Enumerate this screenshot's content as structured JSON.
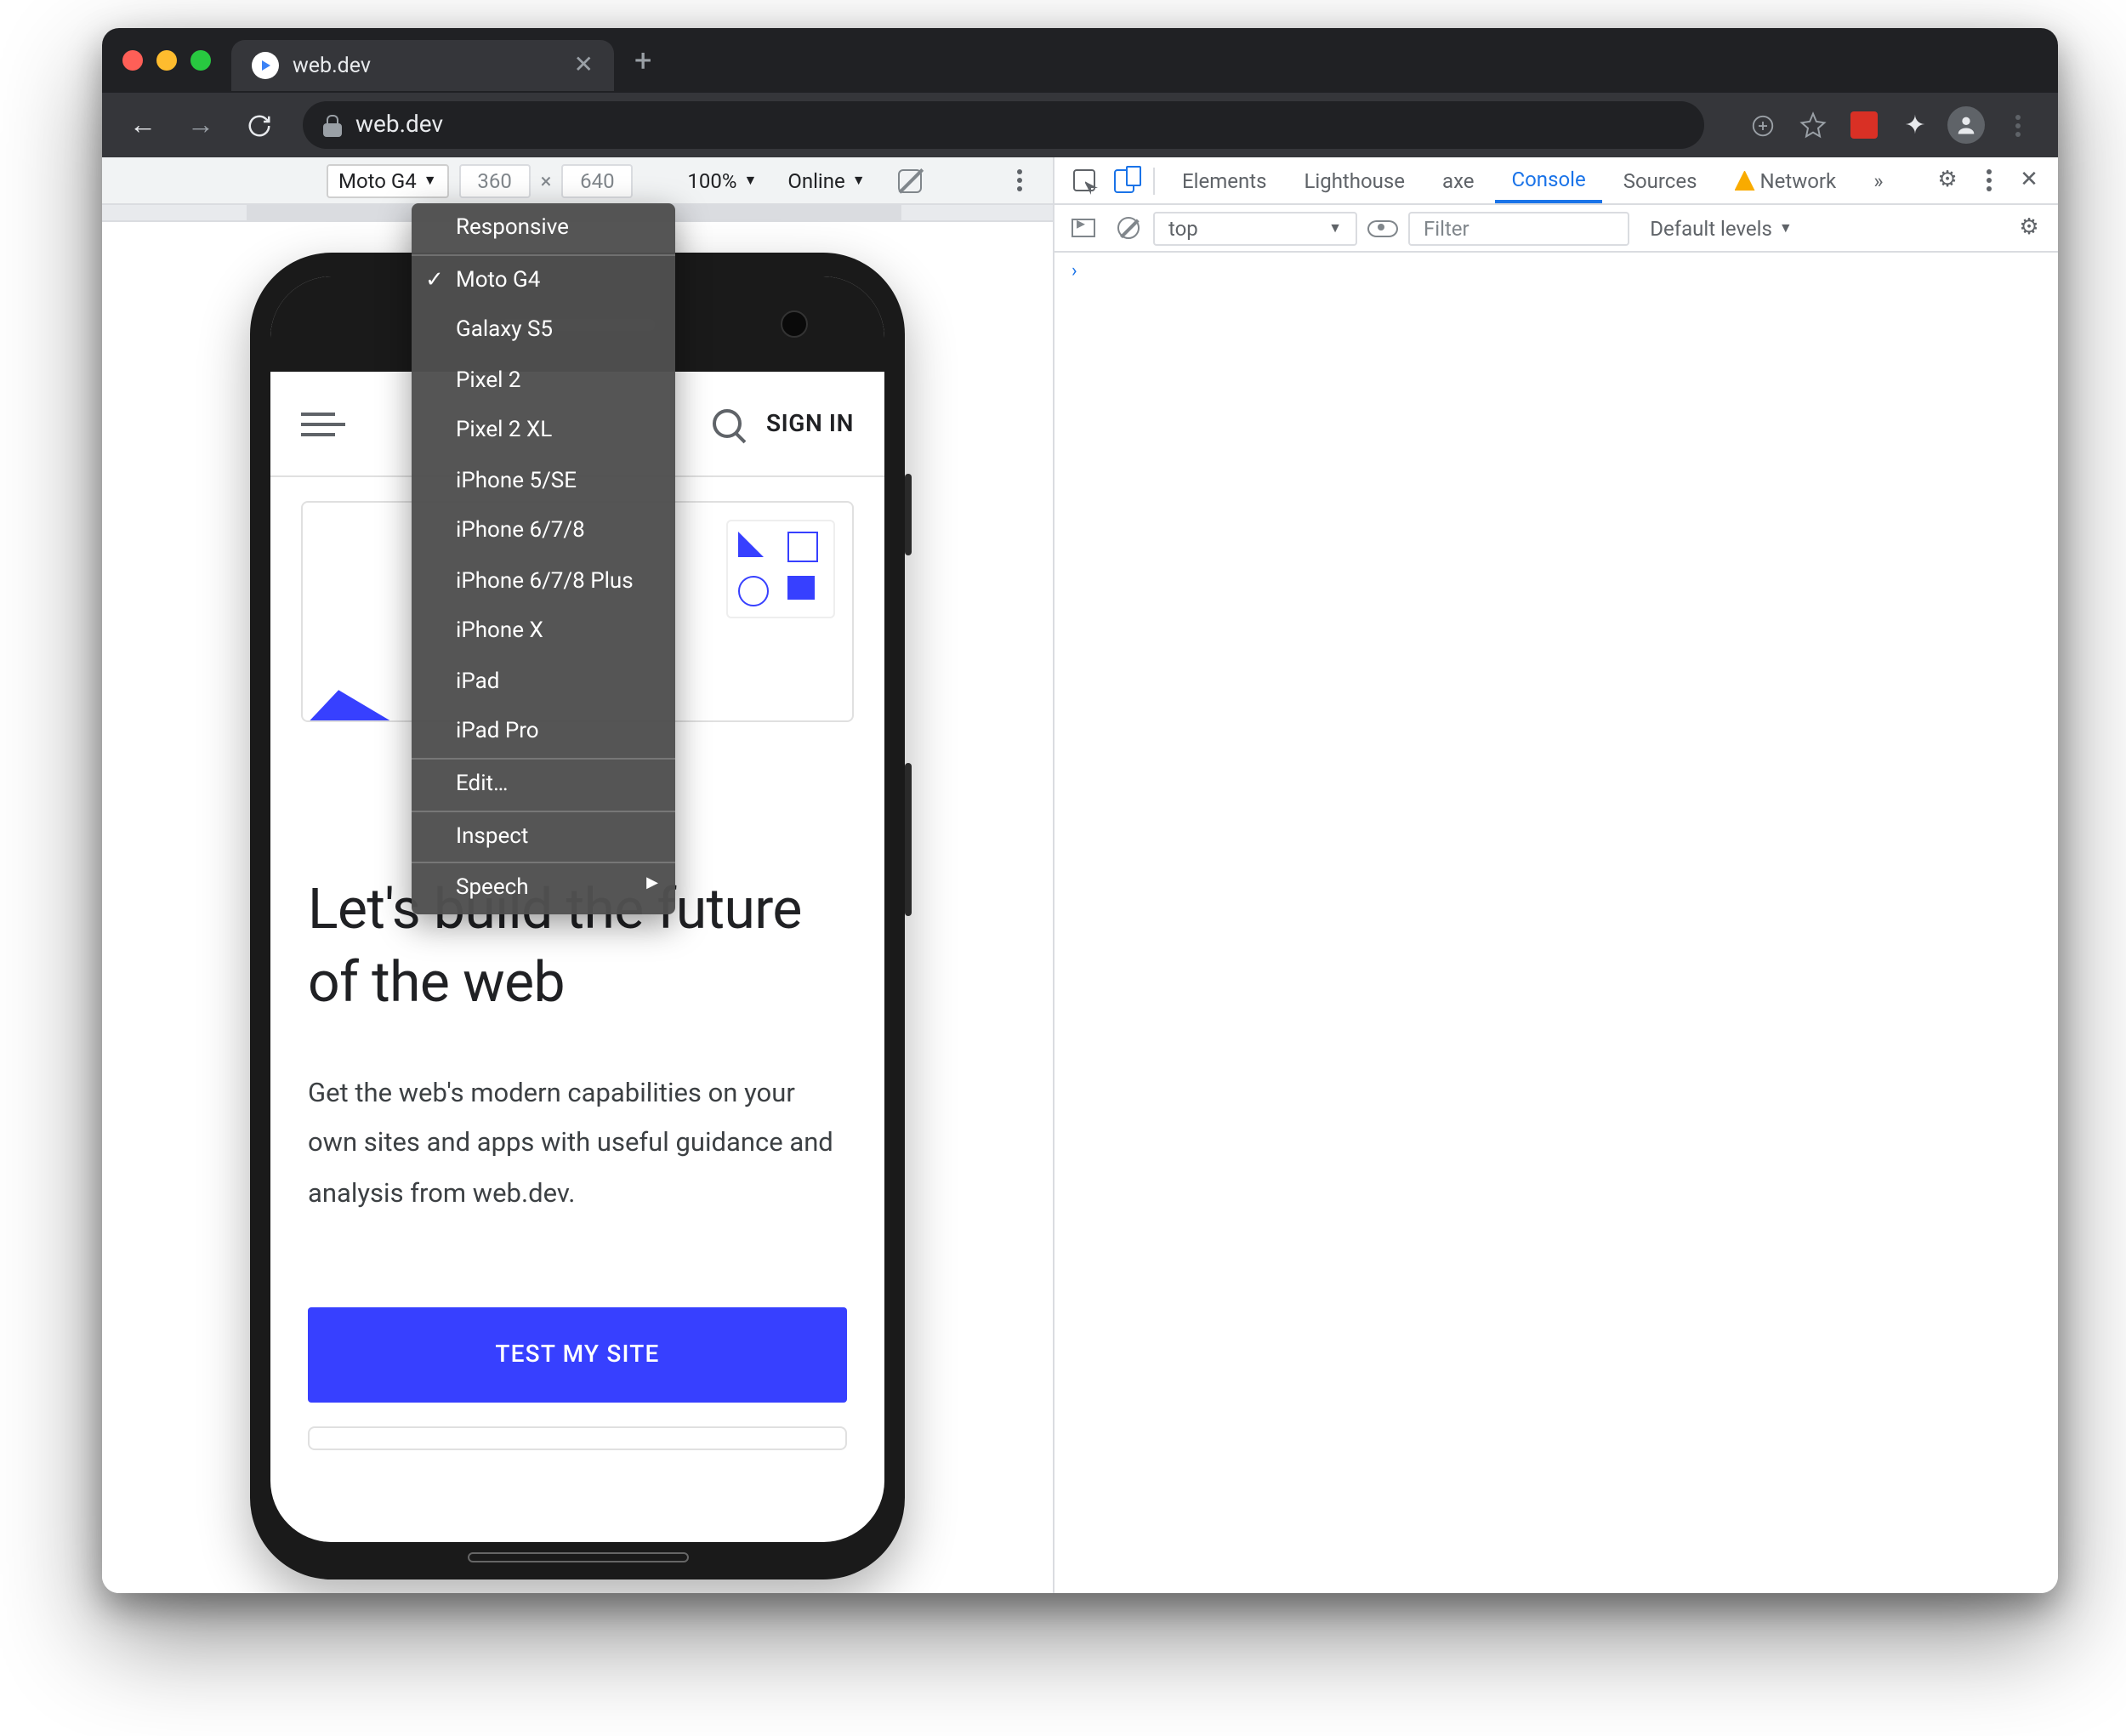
{
  "browser": {
    "tab_title": "web.dev",
    "url": "web.dev"
  },
  "device_toolbar": {
    "device": "Moto G4",
    "width": "360",
    "height": "640",
    "zoom": "100%",
    "throttle": "Online"
  },
  "device_menu": {
    "responsive": "Responsive",
    "devices": [
      "Moto G4",
      "Galaxy S5",
      "Pixel 2",
      "Pixel 2 XL",
      "iPhone 5/SE",
      "iPhone 6/7/8",
      "iPhone 6/7/8 Plus",
      "iPhone X",
      "iPad",
      "iPad Pro"
    ],
    "selected": "Moto G4",
    "edit": "Edit…",
    "inspect": "Inspect",
    "speech": "Speech"
  },
  "site": {
    "sign_in": "SIGN IN",
    "headline": "Let's build the future of the web",
    "sub": "Get the web's modern capabilities on your own sites and apps with useful guidance and analysis from web.dev.",
    "cta": "TEST MY SITE"
  },
  "devtools": {
    "tabs": [
      "Elements",
      "Lighthouse",
      "axe",
      "Console",
      "Sources",
      "Network"
    ],
    "active": "Console",
    "more": "»",
    "console": {
      "context": "top",
      "filter_placeholder": "Filter",
      "levels": "Default levels",
      "prompt": "›"
    }
  }
}
